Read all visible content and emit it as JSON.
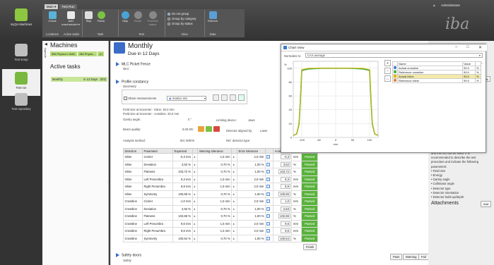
{
  "ribbon": {
    "menu_tab": "Main ▾",
    "active_tab": "Test Run",
    "buttons": [
      {
        "label": "Check",
        "icon": "check-icon"
      },
      {
        "label": "Add unscheduled ▾",
        "icon": "add-icon"
      },
      {
        "label": "Skip",
        "icon": "skip-icon"
      },
      {
        "label": "Finish",
        "icon": "finish-icon"
      },
      {
        "label": "Skip",
        "icon": "skip-test-icon"
      },
      {
        "label": "Reset",
        "icon": "reset-icon"
      },
      {
        "label": "Override status",
        "icon": "override-icon"
      },
      {
        "label": "Refresh",
        "icon": "refresh-icon"
      }
    ],
    "view_options": [
      "Do not group",
      "Group by category",
      "Group by status"
    ],
    "groups": [
      "Locations",
      "Active tasks",
      "Task",
      "Test",
      "View",
      "Data"
    ]
  },
  "user": "Administrator",
  "logo": "iba",
  "nav": {
    "machines": "myQA Machines",
    "items": [
      "Test setup",
      "Test run",
      "Test repository"
    ]
  },
  "machines_panel": {
    "title": "Machines",
    "agenda": "Agenda",
    "chips": [
      "IBA Physics LINAC",
      "IBA Physic...",
      "(1)"
    ],
    "active_title": "Active tasks",
    "task_name": "Monthly",
    "task_due": "in 12 Days",
    "task_count": "(0/3)"
  },
  "detail": {
    "title": "Monthly",
    "due": "Due in 12 Days",
    "sec1": {
      "title": "MLC Picket Fence",
      "sub": "MLC"
    },
    "sec2": {
      "title": "Profile constancy",
      "sub": "Dosimetry",
      "share": "Share measurements",
      "matrix": "matrixx sim",
      "fs1": "Field size at isocenter - inline:  20,0 mm",
      "fs2": "Field size at isocenter - crossline:  20,0 mm",
      "gantry_label": "Gantry angle:",
      "gantry_val": "0 °",
      "limit_label": "Limiting device:",
      "limit_val": "Jaws",
      "beam_label": "Beam quality:",
      "beam_val": "6,00 MV",
      "aligned_label": "Detector aligned by:",
      "aligned_val": "Laser",
      "method_label": "Analysis method:",
      "method_val": "IEC 60976",
      "ref_label": "Ref. detector type:",
      "ref_val": ""
    },
    "table": {
      "headers": [
        "Direction",
        "Parameter",
        "Expected",
        "",
        "Warning tolerance",
        "",
        "Error tolerance",
        "",
        "Actual",
        "",
        "",
        "Status"
      ],
      "rows": [
        [
          "Inline",
          "Center",
          "-0,3 mm",
          "±",
          "1,5 mm",
          "±",
          "2,0 mm",
          "-0,3",
          "mm",
          "Passed"
        ],
        [
          "Inline",
          "Deviation",
          "3,52 %",
          "±",
          "0,70 %",
          "±",
          "1,00 %",
          "3,52",
          "%",
          "Passed"
        ],
        [
          "Inline",
          "Flatness",
          "103,72 %",
          "±",
          "0,70 %",
          "±",
          "1,00 %",
          "103,72",
          "%",
          "Passed"
        ],
        [
          "Inline",
          "Left Penumbra",
          "9,3 mm",
          "±",
          "1,5 mm",
          "±",
          "2,0 mm",
          "9,3",
          "mm",
          "Passed"
        ],
        [
          "Inline",
          "Right Penumbra",
          "8,9 mm",
          "±",
          "1,5 mm",
          "±",
          "2,0 mm",
          "8,9",
          "mm",
          "Passed"
        ],
        [
          "Inline",
          "Symmetry",
          "100,65 %",
          "±",
          "0,70 %",
          "±",
          "1,00 %",
          "100,65",
          "%",
          "Passed"
        ],
        [
          "Crossline",
          "Center",
          "-1,0 mm",
          "±",
          "1,5 mm",
          "±",
          "2,0 mm",
          "1,0",
          "mm",
          "Passed"
        ],
        [
          "Crossline",
          "Deviation",
          "2,63 %",
          "±",
          "0,70 %",
          "±",
          "1,00 %",
          "2,63",
          "%",
          "Passed"
        ],
        [
          "Crossline",
          "Flatness",
          "102,66 %",
          "±",
          "0,70 %",
          "±",
          "1,00 %",
          "102,66",
          "%",
          "Passed"
        ],
        [
          "Crossline",
          "Left Penumbra",
          "9,6 mm",
          "±",
          "1,5 mm",
          "±",
          "2,0 mm",
          "9,6",
          "mm",
          "Passed"
        ],
        [
          "Crossline",
          "Right Penumbra",
          "9,6 mm",
          "±",
          "1,5 mm",
          "±",
          "2,0 mm",
          "9,6",
          "mm",
          "Passed"
        ],
        [
          "Crossline",
          "Symmetry",
          "100,54 %",
          "±",
          "0,70 %",
          "±",
          "1,00 %",
          "100,54",
          "%",
          "Passed"
        ]
      ]
    },
    "finish": "Finish",
    "sec3": {
      "title": "Safety doors",
      "sub": "Safety"
    },
    "buttons": [
      "Pass",
      "Warning",
      "Fail"
    ]
  },
  "chart_window": {
    "title": "Chart View",
    "normalize_label": "Normalize to",
    "normalize_value": "CAX average",
    "legend_headers": [
      "",
      "Name",
      "Value",
      ""
    ],
    "legend": [
      {
        "name": "Actual crossline",
        "value": "99,9",
        "unit": "%",
        "color": "#3a7bd5"
      },
      {
        "name": "Reference crossline",
        "value": "99,9",
        "unit": "%",
        "color": "#3cae3c"
      },
      {
        "name": "Actual inline",
        "value": "99,9",
        "unit": "%",
        "color": "#e0b400"
      },
      {
        "name": "Reference inline",
        "value": "99,9",
        "unit": "%",
        "color": "#e07a2a"
      }
    ]
  },
  "chart_data": {
    "type": "line",
    "ylabel": "%",
    "xlabel": "mm",
    "x_ticks": [
      "-100",
      "-50",
      "0",
      "50",
      "100"
    ],
    "y_ticks": [
      "0",
      "20",
      "40",
      "60",
      "80",
      "100"
    ],
    "xlim": [
      -125,
      125
    ],
    "ylim": [
      0,
      110
    ],
    "series": [
      {
        "name": "Actual crossline",
        "x": [
          -125,
          -115,
          -108,
          -104,
          -100,
          -80,
          -40,
          0,
          40,
          80,
          100,
          104,
          108,
          115,
          125
        ],
        "y": [
          3,
          5,
          20,
          55,
          97,
          99,
          100,
          100,
          100,
          99,
          97,
          55,
          20,
          5,
          3
        ]
      },
      {
        "name": "Actual inline",
        "x": [
          -125,
          -115,
          -108,
          -104,
          -100,
          -80,
          -40,
          0,
          40,
          80,
          100,
          104,
          108,
          115,
          125
        ],
        "y": [
          3,
          5,
          22,
          57,
          98,
          100,
          100,
          100,
          100,
          100,
          98,
          57,
          22,
          5,
          3
        ]
      }
    ]
  },
  "right_panel": {
    "help_lines": [
      "and this run can be used. It is",
      "recommended to describe the test",
      "procedure and indicate the following",
      "parameters:",
      "• Field size",
      "• Energy",
      "• Gantry angle",
      "• Collimator angle",
      "• Detector type",
      "• Detector orientation",
      "• Detector build-up/depth"
    ],
    "attachments": "Attachments",
    "add": "Add"
  }
}
